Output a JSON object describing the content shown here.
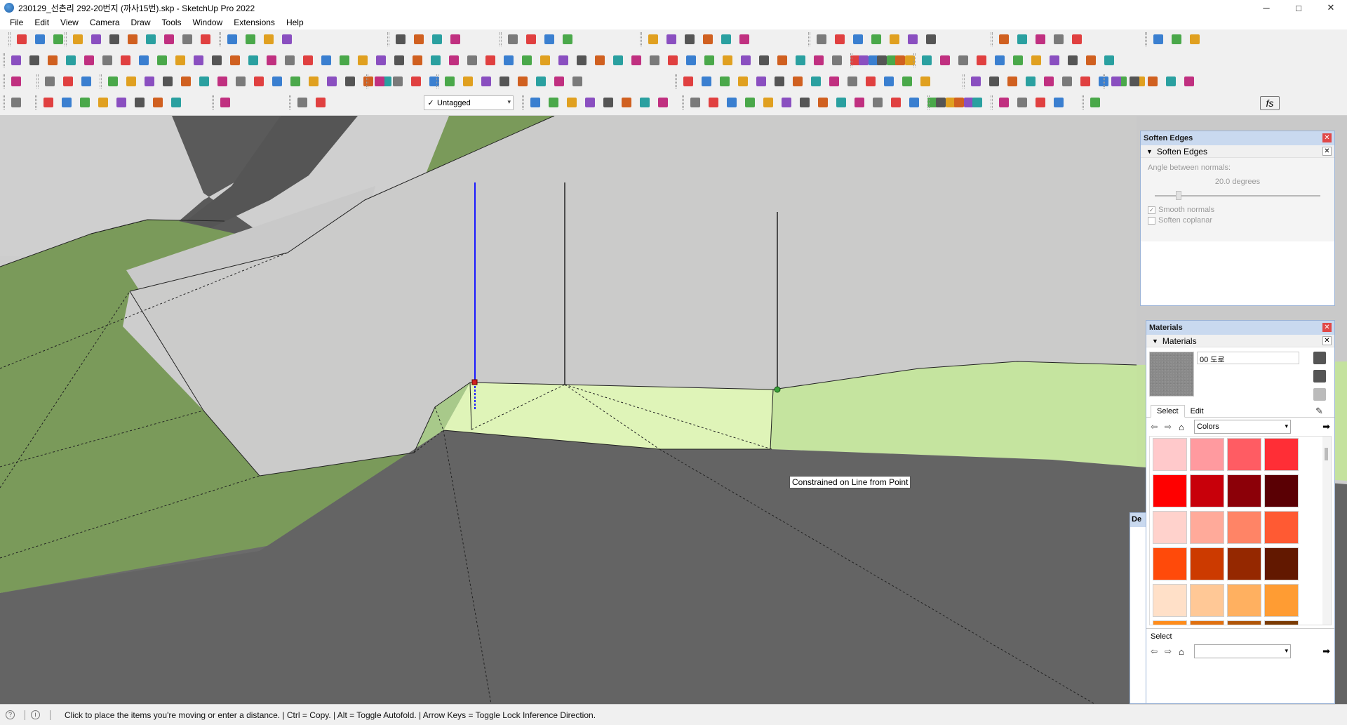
{
  "window": {
    "title": "230129_선촌리 292-20번지 (까사15번).skp - SketchUp Pro 2022",
    "minimize": "─",
    "maximize": "□",
    "close": "✕"
  },
  "menu": [
    "File",
    "Edit",
    "View",
    "Camera",
    "Draw",
    "Tools",
    "Window",
    "Extensions",
    "Help"
  ],
  "toolbar": {
    "tag_selector": {
      "check": "✓",
      "value": "Untagged",
      "arrow": "▾"
    },
    "fs_label": "fs"
  },
  "viewport": {
    "tooltip": "Constrained on Line from Point"
  },
  "soften_panel": {
    "title": "Soften Edges",
    "section": "Soften Edges",
    "angle_label": "Angle between normals:",
    "angle_value": "20.0  degrees",
    "smooth_normals_label": "Smooth normals",
    "smooth_normals_checked": true,
    "soften_coplanar_label": "Soften coplanar",
    "soften_coplanar_checked": false
  },
  "materials_panel": {
    "title": "Materials",
    "section": "Materials",
    "material_name": "00 도로",
    "tabs": [
      "Select",
      "Edit"
    ],
    "active_tab": "Select",
    "library": "Colors",
    "secondary_select_label": "Select",
    "secondary_library": "",
    "swatches": [
      "#ffc9cb",
      "#ff9a9f",
      "#ff5c63",
      "#ff2e36",
      "#ff0000",
      "#c8000a",
      "#8c0008",
      "#5a0004",
      "#ffd2cc",
      "#ffaa9a",
      "#ff8466",
      "#ff5a33",
      "#ff4a0a",
      "#cc3a00",
      "#952800",
      "#621800",
      "#ffe0c8",
      "#ffc896",
      "#ffb060",
      "#ff9c33",
      "#ff8c1a",
      "#e07010",
      "#b05508",
      "#7a3a04"
    ]
  },
  "docked_panel": {
    "label": "De"
  },
  "statusbar": {
    "message": "Click to place the items you're moving or enter a distance. | Ctrl = Copy. | Alt = Toggle Autofold. | Arrow Keys = Toggle Lock Inference Direction."
  }
}
